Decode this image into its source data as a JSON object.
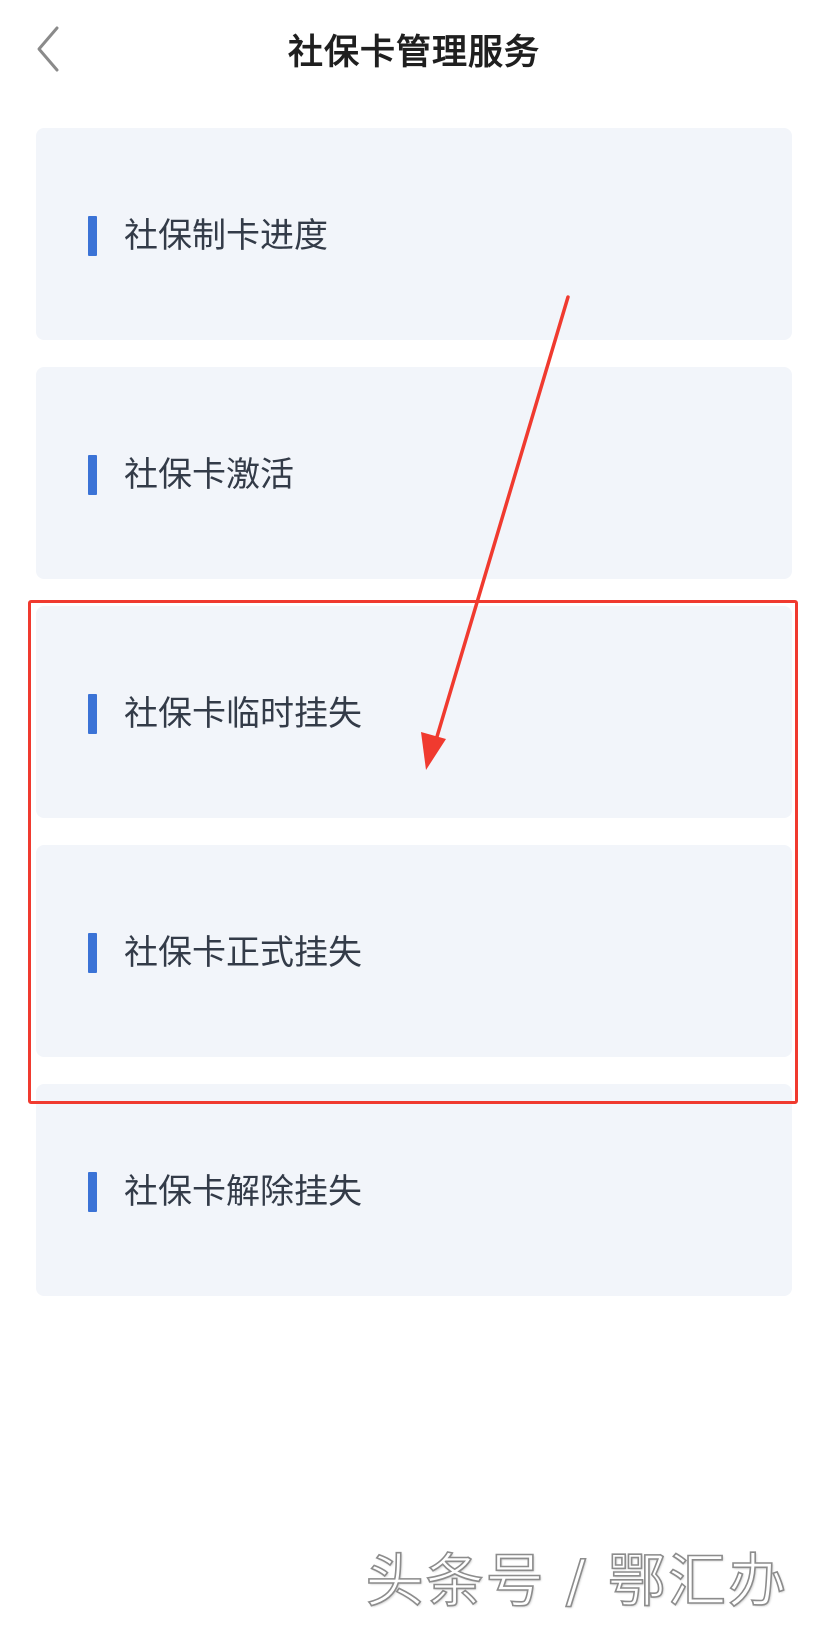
{
  "header": {
    "title": "社保卡管理服务",
    "back_icon": "chevron-left-icon"
  },
  "menu": {
    "items": [
      {
        "label": "社保制卡进度"
      },
      {
        "label": "社保卡激活"
      },
      {
        "label": "社保卡临时挂失"
      },
      {
        "label": "社保卡正式挂失"
      },
      {
        "label": "社保卡解除挂失"
      }
    ]
  },
  "annotation": {
    "highlight_color": "#f03a2f",
    "arrow_color": "#f03a2f"
  },
  "watermark": {
    "text": "头条号 / 鄂汇办"
  },
  "colors": {
    "card_background": "#f2f5fa",
    "accent": "#3b73d6",
    "label_text": "#333b48",
    "title_text": "#1f1f1f"
  }
}
